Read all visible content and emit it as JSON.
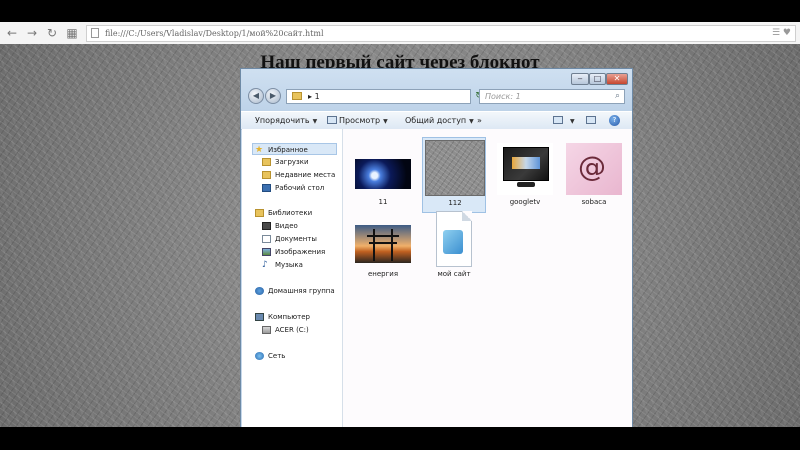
{
  "browser": {
    "url": "file:///C:/Users/Vladislav/Desktop/1/мой%20сайт.html"
  },
  "page": {
    "heading": "Наш первый сайт через блокнот"
  },
  "explorer": {
    "breadcrumb": "1",
    "search_placeholder": "Поиск: 1",
    "toolbar": {
      "organize": "Упорядочить",
      "view": "Просмотр",
      "share": "Общий доступ",
      "more": "»"
    },
    "nav": {
      "favorites": "Избранное",
      "downloads": "Загрузки",
      "recent": "Недавние места",
      "desktop": "Рабочий стол",
      "libraries": "Библиотеки",
      "video": "Видео",
      "documents": "Документы",
      "images": "Изображения",
      "music": "Музыка",
      "homegroup": "Домашняя группа",
      "computer": "Компьютер",
      "drive": "ACER (C:)",
      "network": "Сеть"
    },
    "files": [
      {
        "name": "11",
        "selected": false
      },
      {
        "name": "112",
        "selected": true
      },
      {
        "name": "googletv",
        "selected": false
      },
      {
        "name": "sobaca",
        "selected": false
      },
      {
        "name": "енергия",
        "selected": false
      },
      {
        "name": "мой сайт",
        "selected": false
      }
    ]
  },
  "colors": {
    "accent": "#3b6fb0",
    "selection": "#d9e8f7",
    "close_button": "#c6472f"
  }
}
